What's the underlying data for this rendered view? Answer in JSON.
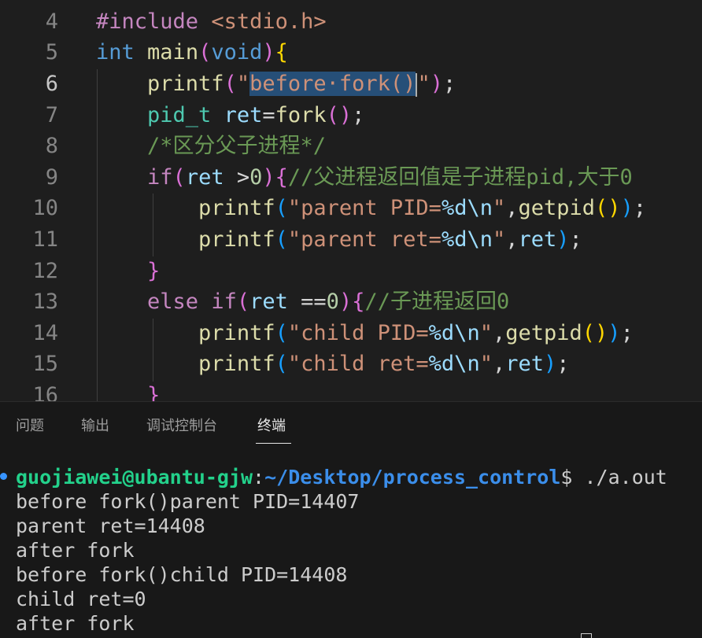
{
  "editor": {
    "lines": [
      {
        "num": "4",
        "parts": [
          {
            "t": "#include ",
            "c": "kw"
          },
          {
            "t": "<stdio.h>",
            "c": "str"
          }
        ]
      },
      {
        "num": "5",
        "parts": [
          {
            "t": "int",
            "c": "ty"
          },
          {
            "t": " ",
            "c": "op"
          },
          {
            "t": "main",
            "c": "fn"
          },
          {
            "t": "(",
            "c": "b2"
          },
          {
            "t": "void",
            "c": "ty"
          },
          {
            "t": ")",
            "c": "b2"
          },
          {
            "t": "{",
            "c": "b1"
          }
        ]
      },
      {
        "num": "6",
        "active": true,
        "parts": [
          {
            "t": "    ",
            "c": "op"
          },
          {
            "t": "printf",
            "c": "fn"
          },
          {
            "t": "(",
            "c": "b2"
          },
          {
            "t": "\"",
            "c": "str"
          },
          {
            "t": "before·fork()",
            "c": "str",
            "sel": true
          },
          {
            "cursor": true
          },
          {
            "t": "\"",
            "c": "str"
          },
          {
            "t": ")",
            "c": "b2"
          },
          {
            "t": ";",
            "c": "op"
          }
        ]
      },
      {
        "num": "7",
        "parts": [
          {
            "t": "    ",
            "c": "op"
          },
          {
            "t": "pid_t",
            "c": "tt"
          },
          {
            "t": " ",
            "c": "op"
          },
          {
            "t": "ret",
            "c": "var"
          },
          {
            "t": "=",
            "c": "op"
          },
          {
            "t": "fork",
            "c": "fn"
          },
          {
            "t": "()",
            "c": "b2"
          },
          {
            "t": ";",
            "c": "op"
          }
        ]
      },
      {
        "num": "8",
        "parts": [
          {
            "t": "    ",
            "c": "op"
          },
          {
            "t": "/*区分父子进程*/",
            "c": "cm"
          }
        ]
      },
      {
        "num": "9",
        "parts": [
          {
            "t": "    ",
            "c": "op"
          },
          {
            "t": "if",
            "c": "kw"
          },
          {
            "t": "(",
            "c": "b2"
          },
          {
            "t": "ret",
            "c": "var"
          },
          {
            "t": " >",
            "c": "op"
          },
          {
            "t": "0",
            "c": "num"
          },
          {
            "t": ")",
            "c": "b2"
          },
          {
            "t": "{",
            "c": "b2"
          },
          {
            "t": "//父进程返回值是子进程pid,大于0",
            "c": "cm"
          }
        ]
      },
      {
        "num": "10",
        "parts": [
          {
            "t": "        ",
            "c": "op"
          },
          {
            "t": "printf",
            "c": "fn"
          },
          {
            "t": "(",
            "c": "b3"
          },
          {
            "t": "\"parent PID=",
            "c": "str"
          },
          {
            "t": "%d\\n",
            "c": "var"
          },
          {
            "t": "\"",
            "c": "str"
          },
          {
            "t": ",",
            "c": "op"
          },
          {
            "t": "getpid",
            "c": "fn"
          },
          {
            "t": "()",
            "c": "b1"
          },
          {
            "t": ")",
            "c": "b3"
          },
          {
            "t": ";",
            "c": "op"
          }
        ]
      },
      {
        "num": "11",
        "parts": [
          {
            "t": "        ",
            "c": "op"
          },
          {
            "t": "printf",
            "c": "fn"
          },
          {
            "t": "(",
            "c": "b3"
          },
          {
            "t": "\"parent ret=",
            "c": "str"
          },
          {
            "t": "%d\\n",
            "c": "var"
          },
          {
            "t": "\"",
            "c": "str"
          },
          {
            "t": ",",
            "c": "op"
          },
          {
            "t": "ret",
            "c": "var"
          },
          {
            "t": ")",
            "c": "b3"
          },
          {
            "t": ";",
            "c": "op"
          }
        ]
      },
      {
        "num": "12",
        "parts": [
          {
            "t": "    ",
            "c": "op"
          },
          {
            "t": "}",
            "c": "b2"
          }
        ]
      },
      {
        "num": "13",
        "parts": [
          {
            "t": "    ",
            "c": "op"
          },
          {
            "t": "else",
            "c": "kw"
          },
          {
            "t": " ",
            "c": "op"
          },
          {
            "t": "if",
            "c": "kw"
          },
          {
            "t": "(",
            "c": "b2"
          },
          {
            "t": "ret",
            "c": "var"
          },
          {
            "t": " ==",
            "c": "op"
          },
          {
            "t": "0",
            "c": "num"
          },
          {
            "t": ")",
            "c": "b2"
          },
          {
            "t": "{",
            "c": "b2"
          },
          {
            "t": "//子进程返回0",
            "c": "cm"
          }
        ]
      },
      {
        "num": "14",
        "parts": [
          {
            "t": "        ",
            "c": "op"
          },
          {
            "t": "printf",
            "c": "fn"
          },
          {
            "t": "(",
            "c": "b3"
          },
          {
            "t": "\"child PID=",
            "c": "str"
          },
          {
            "t": "%d\\n",
            "c": "var"
          },
          {
            "t": "\"",
            "c": "str"
          },
          {
            "t": ",",
            "c": "op"
          },
          {
            "t": "getpid",
            "c": "fn"
          },
          {
            "t": "()",
            "c": "b1"
          },
          {
            "t": ")",
            "c": "b3"
          },
          {
            "t": ";",
            "c": "op"
          }
        ]
      },
      {
        "num": "15",
        "parts": [
          {
            "t": "        ",
            "c": "op"
          },
          {
            "t": "printf",
            "c": "fn"
          },
          {
            "t": "(",
            "c": "b3"
          },
          {
            "t": "\"child ret=",
            "c": "str"
          },
          {
            "t": "%d\\n",
            "c": "var"
          },
          {
            "t": "\"",
            "c": "str"
          },
          {
            "t": ",",
            "c": "op"
          },
          {
            "t": "ret",
            "c": "var"
          },
          {
            "t": ")",
            "c": "b3"
          },
          {
            "t": ";",
            "c": "op"
          }
        ]
      },
      {
        "num": "16",
        "parts": [
          {
            "t": "    ",
            "c": "op"
          },
          {
            "t": "}",
            "c": "b2"
          }
        ]
      }
    ]
  },
  "panel": {
    "tabs": [
      "问题",
      "输出",
      "调试控制台",
      "终端"
    ],
    "active_tab": "终端",
    "prompt_user": "guojiawei@ubantu-gjw",
    "prompt_sep": ":",
    "prompt_path": "~/Desktop/process_control",
    "prompt_symbol": "$ ",
    "command": "./a.out",
    "output": [
      "before fork()parent PID=14407",
      "parent ret=14408",
      "after fork",
      "before fork()child PID=14408",
      "child ret=0",
      "after fork"
    ]
  }
}
